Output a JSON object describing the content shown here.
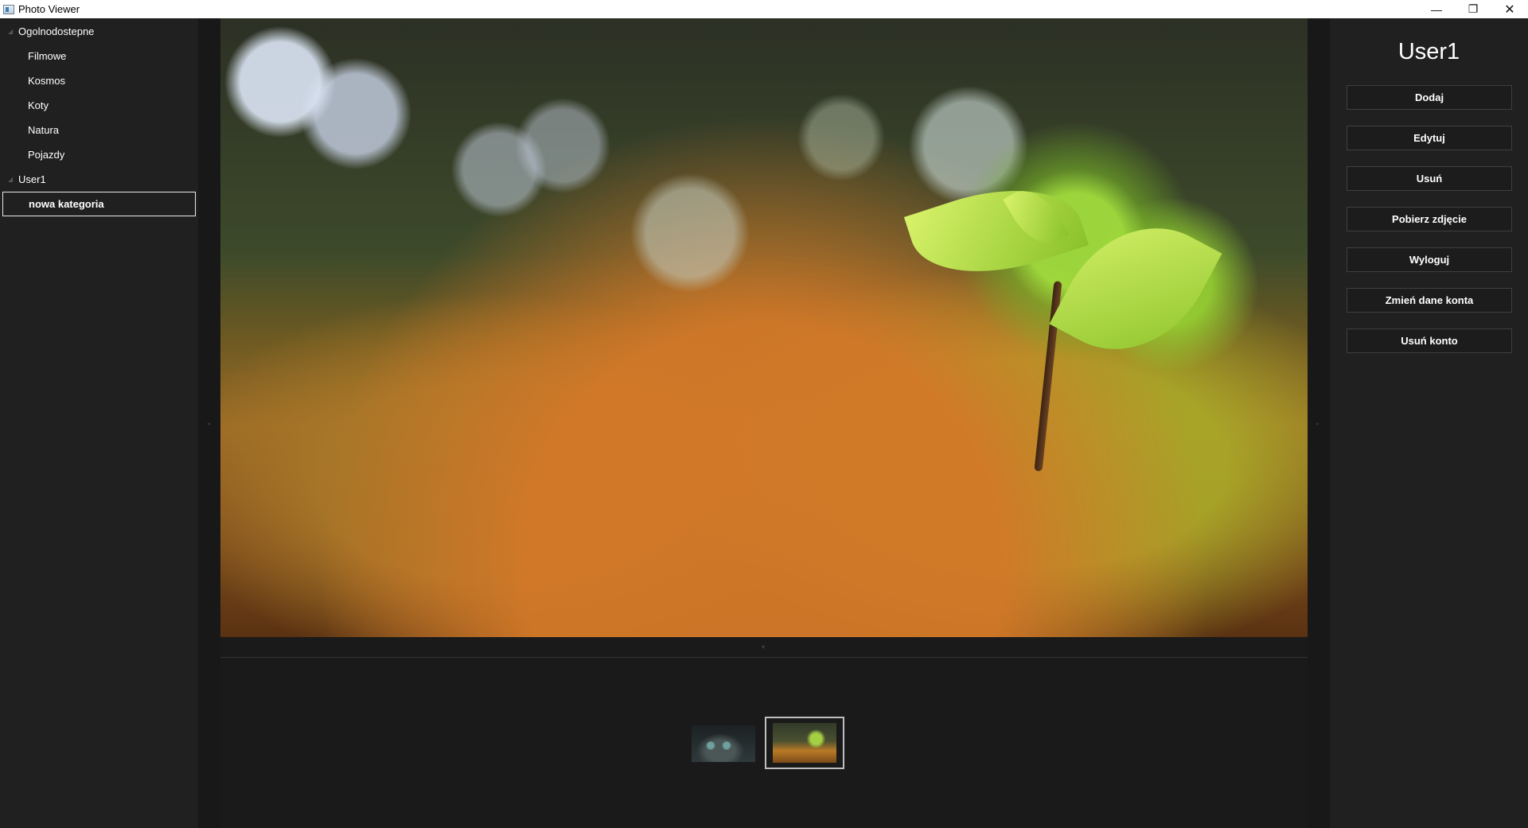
{
  "window": {
    "title": "Photo Viewer",
    "minimize_glyph": "—",
    "restore_glyph": "❐",
    "close_glyph": "✕"
  },
  "sidebar": {
    "groups": [
      {
        "label": "Ogolnodostepne",
        "items": [
          "Filmowe",
          "Kosmos",
          "Koty",
          "Natura",
          "Pojazdy"
        ]
      },
      {
        "label": "User1",
        "items": [
          "nowa kategoria"
        ],
        "selected": "nowa kategoria"
      }
    ]
  },
  "viewer": {
    "image_icon": "photo-moss-seedling"
  },
  "thumbnails": {
    "items": [
      {
        "icon": "cat-photo-thumbnail",
        "selected": false
      },
      {
        "icon": "moss-seedling-photo-thumbnail",
        "selected": true
      }
    ]
  },
  "account": {
    "username": "User1",
    "buttons": {
      "add": "Dodaj",
      "edit": "Edytuj",
      "delete": "Usuń",
      "download": "Pobierz zdjęcie",
      "logout": "Wyloguj",
      "change_account": "Zmień dane konta",
      "delete_account": "Usuń konto"
    }
  },
  "colors": {
    "background": "#1c1c1c",
    "panel": "#202020",
    "text": "#ffffff",
    "selection_border": "#e8e8e8"
  }
}
